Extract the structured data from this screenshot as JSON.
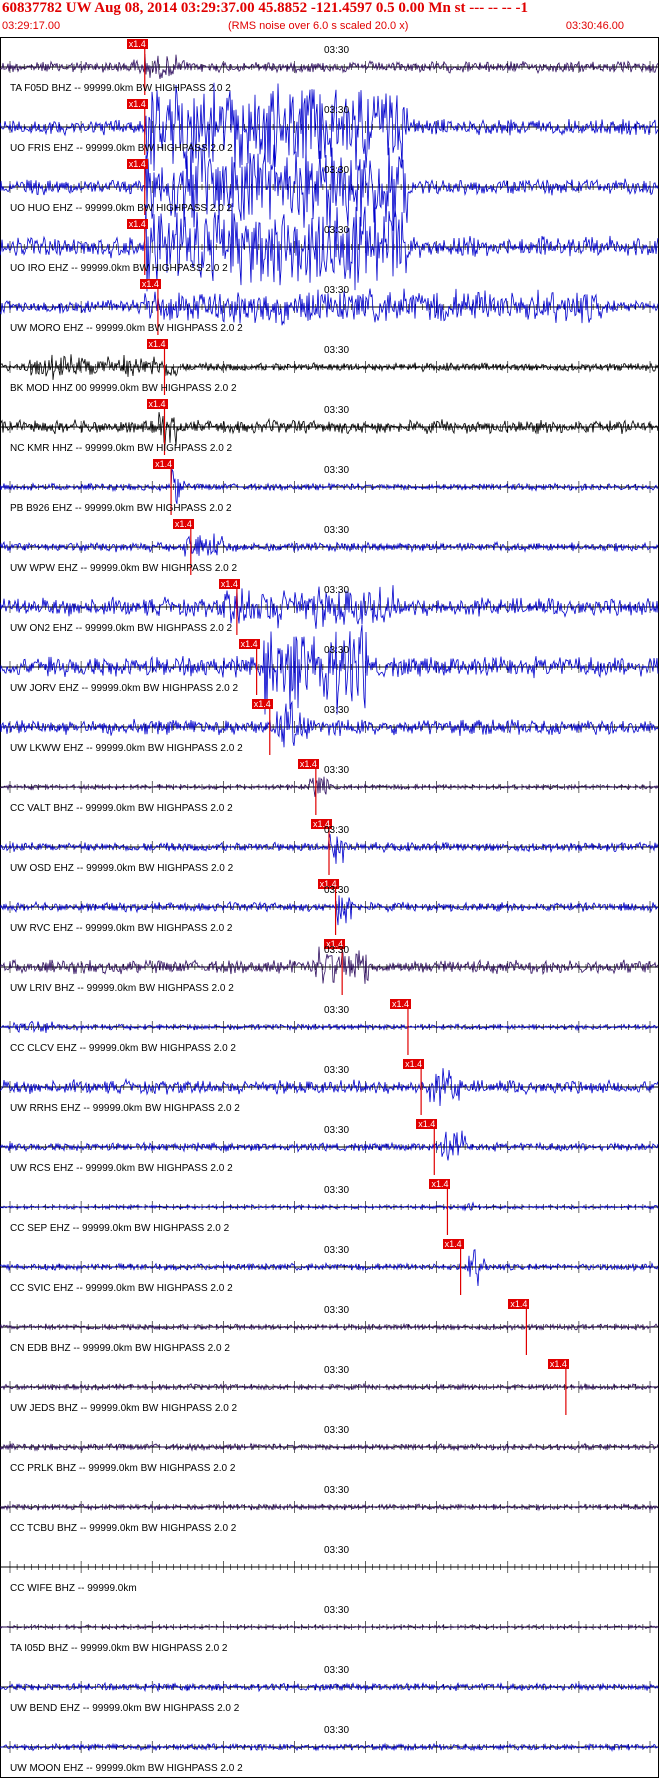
{
  "header": {
    "title": "60837782 UW Aug 08, 2014 03:29:37.00   45.8852  -121.4597  0.5 0.00 Mn st --- -- --   -1",
    "start_time": "03:29:17.00",
    "rms_note": "(RMS noise over 6.0 s scaled 20.0 x)",
    "end_time": "03:30:46.00"
  },
  "colors": {
    "title": "#e00000",
    "pick": "#e00000",
    "trace_blue": "#0000cc",
    "trace_dark": "#301060",
    "trace_black": "#000000"
  },
  "time_tick_label": "03:30",
  "pick_label": "x1.4",
  "traces": [
    {
      "label": "TA F05D BHZ -- 99999.0km BW  HIGHPASS  2.0  2",
      "color": "dark",
      "amp": 0.25,
      "pick": 0.22,
      "burst": [
        0.2,
        0.28,
        0.55
      ]
    },
    {
      "label": "UO FRIS EHZ -- 99999.0km BW  HIGHPASS  2.0  2",
      "color": "blue",
      "amp": 0.35,
      "pick": 0.22,
      "burst": [
        0.22,
        0.62,
        1.9
      ]
    },
    {
      "label": "UO HUO EHZ -- 99999.0km BW  HIGHPASS  2.0  2",
      "color": "blue",
      "amp": 0.35,
      "pick": 0.22,
      "burst": [
        0.22,
        0.62,
        1.9
      ]
    },
    {
      "label": "UO IRO EHZ -- 99999.0km BW  HIGHPASS  2.0  2",
      "color": "blue",
      "amp": 0.45,
      "pick": 0.22,
      "burst": [
        0.22,
        0.62,
        1.9
      ]
    },
    {
      "label": "UW MORO EHZ -- 99999.0km BW  HIGHPASS  2.0  2",
      "color": "blue",
      "amp": 0.3,
      "pick": 0.24,
      "burst": [
        0.22,
        0.92,
        0.75
      ]
    },
    {
      "label": "BK MOD HHZ 00 99999.0km BW  HIGHPASS  2.0  2",
      "color": "black",
      "amp": 0.18,
      "pick": 0.25,
      "burst": [
        0.04,
        0.27,
        0.55
      ]
    },
    {
      "label": "NC KMR HHZ -- 99999.0km BW  HIGHPASS  2.0  2",
      "color": "black",
      "amp": 0.3,
      "pick": 0.25,
      "burst": [
        0.24,
        0.27,
        0.75
      ]
    },
    {
      "label": "PB B926 EHZ -- 99999.0km BW  HIGHPASS  2.0  2",
      "color": "blue",
      "amp": 0.15,
      "pick": 0.26,
      "burst": [
        0.26,
        0.28,
        0.9
      ]
    },
    {
      "label": "UW WPW EHZ -- 99999.0km BW  HIGHPASS  2.0  2",
      "color": "blue",
      "amp": 0.2,
      "pick": 0.29,
      "burst": [
        0.28,
        0.34,
        0.7
      ]
    },
    {
      "label": "UW ON2 EHZ -- 99999.0km BW  HIGHPASS  2.0  2",
      "color": "blue",
      "amp": 0.4,
      "pick": 0.36,
      "burst": [
        0.34,
        0.6,
        0.9
      ]
    },
    {
      "label": "UW JORV EHZ -- 99999.0km BW  HIGHPASS  2.0  2",
      "color": "blue",
      "amp": 0.45,
      "pick": 0.39,
      "burst": [
        0.4,
        0.56,
        1.9
      ]
    },
    {
      "label": "UW LKWW EHZ -- 99999.0km BW  HIGHPASS  2.0  2",
      "color": "blue",
      "amp": 0.35,
      "pick": 0.41,
      "burst": [
        0.42,
        0.47,
        1.1
      ]
    },
    {
      "label": "CC VALT BHZ -- 99999.0km BW  HIGHPASS  2.0  2",
      "color": "dark",
      "amp": 0.1,
      "pick": 0.48,
      "burst": [
        0.47,
        0.5,
        0.6
      ]
    },
    {
      "label": "UW OSD EHZ -- 99999.0km BW  HIGHPASS  2.0  2",
      "color": "blue",
      "amp": 0.2,
      "pick": 0.5,
      "burst": [
        0.5,
        0.53,
        0.85
      ]
    },
    {
      "label": "UW RVC EHZ -- 99999.0km BW  HIGHPASS  2.0  2",
      "color": "blue",
      "amp": 0.2,
      "pick": 0.51,
      "burst": [
        0.51,
        0.54,
        0.85
      ]
    },
    {
      "label": "UW LRIV BHZ -- 99999.0km BW  HIGHPASS  2.0  2",
      "color": "dark",
      "amp": 0.3,
      "pick": 0.52,
      "burst": [
        0.48,
        0.56,
        0.95
      ]
    },
    {
      "label": "CC CLCV EHZ -- 99999.0km BW  HIGHPASS  2.0  2",
      "color": "blue",
      "amp": 0.12,
      "pick": 0.62,
      "burst": [
        0.02,
        0.08,
        0.3
      ]
    },
    {
      "label": "UW RRHS EHZ -- 99999.0km BW  HIGHPASS  2.0  2",
      "color": "blue",
      "amp": 0.3,
      "pick": 0.64,
      "burst": [
        0.65,
        0.7,
        0.8
      ]
    },
    {
      "label": "UW RCS EHZ -- 99999.0km BW  HIGHPASS  2.0  2",
      "color": "blue",
      "amp": 0.18,
      "pick": 0.66,
      "burst": [
        0.67,
        0.71,
        0.7
      ]
    },
    {
      "label": "CC SEP EHZ -- 99999.0km BW  HIGHPASS  2.0  2",
      "color": "blue",
      "amp": 0.08,
      "pick": 0.68,
      "burst": [
        0.7,
        0.72,
        0.2
      ]
    },
    {
      "label": "CC SVIC EHZ -- 99999.0km BW  HIGHPASS  2.0  2",
      "color": "blue",
      "amp": 0.15,
      "pick": 0.7,
      "burst": [
        0.71,
        0.74,
        0.9
      ]
    },
    {
      "label": "CN EDB BHZ -- 99999.0km BW  HIGHPASS  2.0  2",
      "color": "dark",
      "amp": 0.12,
      "pick": 0.8,
      "burst": [
        0.8,
        0.8,
        0.1
      ]
    },
    {
      "label": "UW JEDS BHZ -- 99999.0km BW  HIGHPASS  2.0  2",
      "color": "dark",
      "amp": 0.12,
      "pick": 0.86,
      "burst": [
        0.86,
        0.86,
        0.1
      ]
    },
    {
      "label": "CC PRLK BHZ -- 99999.0km BW  HIGHPASS  2.0  2",
      "color": "dark",
      "amp": 0.14,
      "pick": null,
      "burst": null
    },
    {
      "label": "CC TCBU BHZ -- 99999.0km BW  HIGHPASS  2.0  2",
      "color": "dark",
      "amp": 0.12,
      "pick": null,
      "burst": null
    },
    {
      "label": "CC WIFE BHZ -- 99999.0km",
      "color": "dark",
      "amp": 0.0,
      "pick": null,
      "burst": null
    },
    {
      "label": "TA I05D BHZ -- 99999.0km BW  HIGHPASS  2.0  2",
      "color": "dark",
      "amp": 0.07,
      "pick": null,
      "burst": null
    },
    {
      "label": "UW BEND EHZ -- 99999.0km BW  HIGHPASS  2.0  2",
      "color": "blue",
      "amp": 0.16,
      "pick": null,
      "burst": null
    },
    {
      "label": "UW MOON EHZ -- 99999.0km BW  HIGHPASS  2.0  2",
      "color": "blue",
      "amp": 0.14,
      "pick": null,
      "burst": null
    }
  ]
}
